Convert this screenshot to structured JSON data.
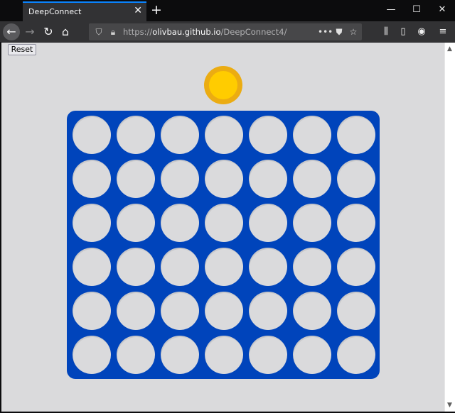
{
  "browser": {
    "tab_title": "DeepConnect",
    "tab_close_icon": "close-icon",
    "new_tab_icon": "plus-icon",
    "url_scheme": "https://",
    "url_host": "olivbau.github.io",
    "url_path": "/DeepConnect4/",
    "window_controls": [
      "minimize-icon",
      "maximize-icon",
      "close-icon"
    ]
  },
  "page": {
    "reset_label": "Reset",
    "current_token_color": "#ffcc00",
    "board_color": "#0044bb",
    "board": {
      "rows": 6,
      "columns": 7,
      "cells": [
        [
          "empty",
          "empty",
          "empty",
          "empty",
          "empty",
          "empty",
          "empty"
        ],
        [
          "empty",
          "empty",
          "empty",
          "empty",
          "empty",
          "empty",
          "empty"
        ],
        [
          "empty",
          "empty",
          "empty",
          "empty",
          "empty",
          "empty",
          "empty"
        ],
        [
          "empty",
          "empty",
          "empty",
          "empty",
          "empty",
          "empty",
          "empty"
        ],
        [
          "empty",
          "empty",
          "empty",
          "empty",
          "empty",
          "empty",
          "empty"
        ],
        [
          "empty",
          "empty",
          "empty",
          "empty",
          "empty",
          "empty",
          "empty"
        ]
      ]
    }
  }
}
